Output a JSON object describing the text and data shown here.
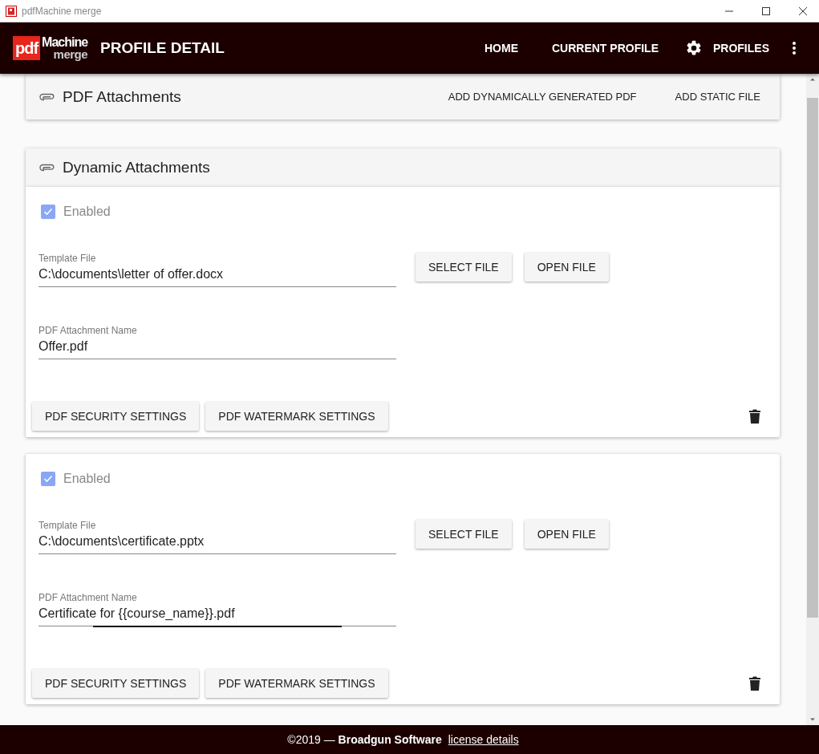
{
  "window": {
    "title": "pdfMachine merge"
  },
  "logo": {
    "badge": "pdf",
    "name": "Machine",
    "sub": "merge"
  },
  "header": {
    "title": "PROFILE DETAIL",
    "nav": [
      {
        "label": "HOME",
        "kind": "link"
      },
      {
        "label": "CURRENT PROFILE",
        "kind": "link"
      },
      {
        "label": "PROFILES",
        "kind": "gear"
      }
    ]
  },
  "attachments_bar": {
    "title": "PDF Attachments",
    "actions": [
      "ADD DYNAMICALLY GENERATED PDF",
      "ADD STATIC FILE"
    ]
  },
  "dynamic": {
    "title": "Dynamic Attachments",
    "items": [
      {
        "enabled_label": "Enabled",
        "enabled": true,
        "template_label": "Template File",
        "template_value": "C:\\documents\\letter of offer.docx",
        "buttons": [
          "SELECT FILE",
          "OPEN FILE"
        ],
        "name_label": "PDF Attachment Name",
        "name_value": "Offer.pdf",
        "name_focused": false,
        "footer_buttons": [
          "PDF SECURITY SETTINGS",
          "PDF WATERMARK SETTINGS"
        ]
      },
      {
        "enabled_label": "Enabled",
        "enabled": true,
        "template_label": "Template File",
        "template_value": "C:\\documents\\certificate.pptx",
        "buttons": [
          "SELECT FILE",
          "OPEN FILE"
        ],
        "name_label": "PDF Attachment Name",
        "name_value": "Certificate for {{course_name}}.pdf",
        "name_focused": true,
        "footer_buttons": [
          "PDF SECURITY SETTINGS",
          "PDF WATERMARK SETTINGS"
        ]
      }
    ]
  },
  "footer": {
    "text": "©2019 — **Broadgun Software**",
    "link": "license details"
  }
}
